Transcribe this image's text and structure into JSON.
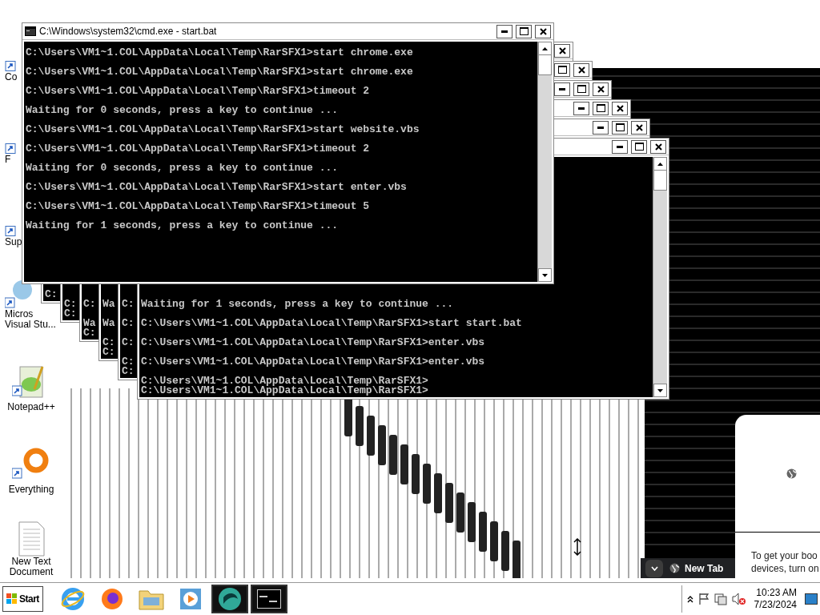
{
  "desktop_icons": [
    {
      "kind": "hidden",
      "cut": true,
      "lines": [
        "Co"
      ]
    },
    {
      "kind": "hidden",
      "cut": true,
      "lines": [
        "F"
      ]
    },
    {
      "kind": "hidden",
      "cut": true,
      "lines": [
        "Sup"
      ]
    },
    {
      "kind": "studio",
      "cut": true,
      "lines": [
        "Micros",
        "Visual Stu..."
      ]
    },
    {
      "kind": "notepad",
      "cut": false,
      "lines": [
        "Notepad++"
      ]
    },
    {
      "kind": "everything",
      "cut": false,
      "lines": [
        "Everything"
      ]
    },
    {
      "kind": "textfile",
      "cut": false,
      "lines": [
        "New Text",
        "Document"
      ]
    }
  ],
  "front_window": {
    "title": "C:\\Windows\\system32\\cmd.exe - start.bat",
    "lines": [
      "C:\\Users\\VM1~1.COL\\AppData\\Local\\Temp\\RarSFX1>start chrome.exe",
      "C:\\Users\\VM1~1.COL\\AppData\\Local\\Temp\\RarSFX1>start chrome.exe",
      "C:\\Users\\VM1~1.COL\\AppData\\Local\\Temp\\RarSFX1>timeout 2",
      "Waiting for 0 seconds, press a key to continue ...",
      "C:\\Users\\VM1~1.COL\\AppData\\Local\\Temp\\RarSFX1>start website.vbs",
      "C:\\Users\\VM1~1.COL\\AppData\\Local\\Temp\\RarSFX1>timeout 2",
      "Waiting for 0 seconds, press a key to continue ...",
      "C:\\Users\\VM1~1.COL\\AppData\\Local\\Temp\\RarSFX1>start enter.vbs",
      "C:\\Users\\VM1~1.COL\\AppData\\Local\\Temp\\RarSFX1>timeout 5",
      "Waiting for 1 seconds, press a key to continue ..."
    ]
  },
  "back_windows": [
    {
      "lines": [
        "C:"
      ]
    },
    {
      "lines": [
        "C:",
        "C:"
      ]
    },
    {
      "lines": [
        "C:",
        "Wa",
        "C:"
      ]
    },
    {
      "lines": [
        "Wa",
        "Wa",
        "C:",
        "C:"
      ]
    },
    {
      "lines": [
        "C:",
        "C:",
        "C:",
        "C:",
        "C:"
      ]
    },
    {
      "lines": [
        "Waiting for 1 seconds, press a key to continue ...",
        "C:\\Users\\VM1~1.COL\\AppData\\Local\\Temp\\RarSFX1>start start.bat",
        "C:\\Users\\VM1~1.COL\\AppData\\Local\\Temp\\RarSFX1>enter.vbs",
        "C:\\Users\\VM1~1.COL\\AppData\\Local\\Temp\\RarSFX1>enter.vbs",
        "C:\\Users\\VM1~1.COL\\AppData\\Local\\Temp\\RarSFX1>",
        "C:\\Users\\VM1~1.COL\\AppData\\Local\\Temp\\RarSFX1>"
      ]
    }
  ],
  "browser": {
    "tab": "New Tab",
    "popup_lines": [
      "To get your boo",
      "devices, turn on"
    ]
  },
  "taskbar": {
    "start": "Start",
    "apps": [
      {
        "kind": "ie",
        "selected": false
      },
      {
        "kind": "firefox",
        "selected": false
      },
      {
        "kind": "folder",
        "selected": false
      },
      {
        "kind": "media",
        "selected": false
      },
      {
        "kind": "teal",
        "selected": true
      },
      {
        "kind": "cmd",
        "selected": true
      }
    ],
    "time": "10:23 AM",
    "date": "7/23/2024"
  }
}
